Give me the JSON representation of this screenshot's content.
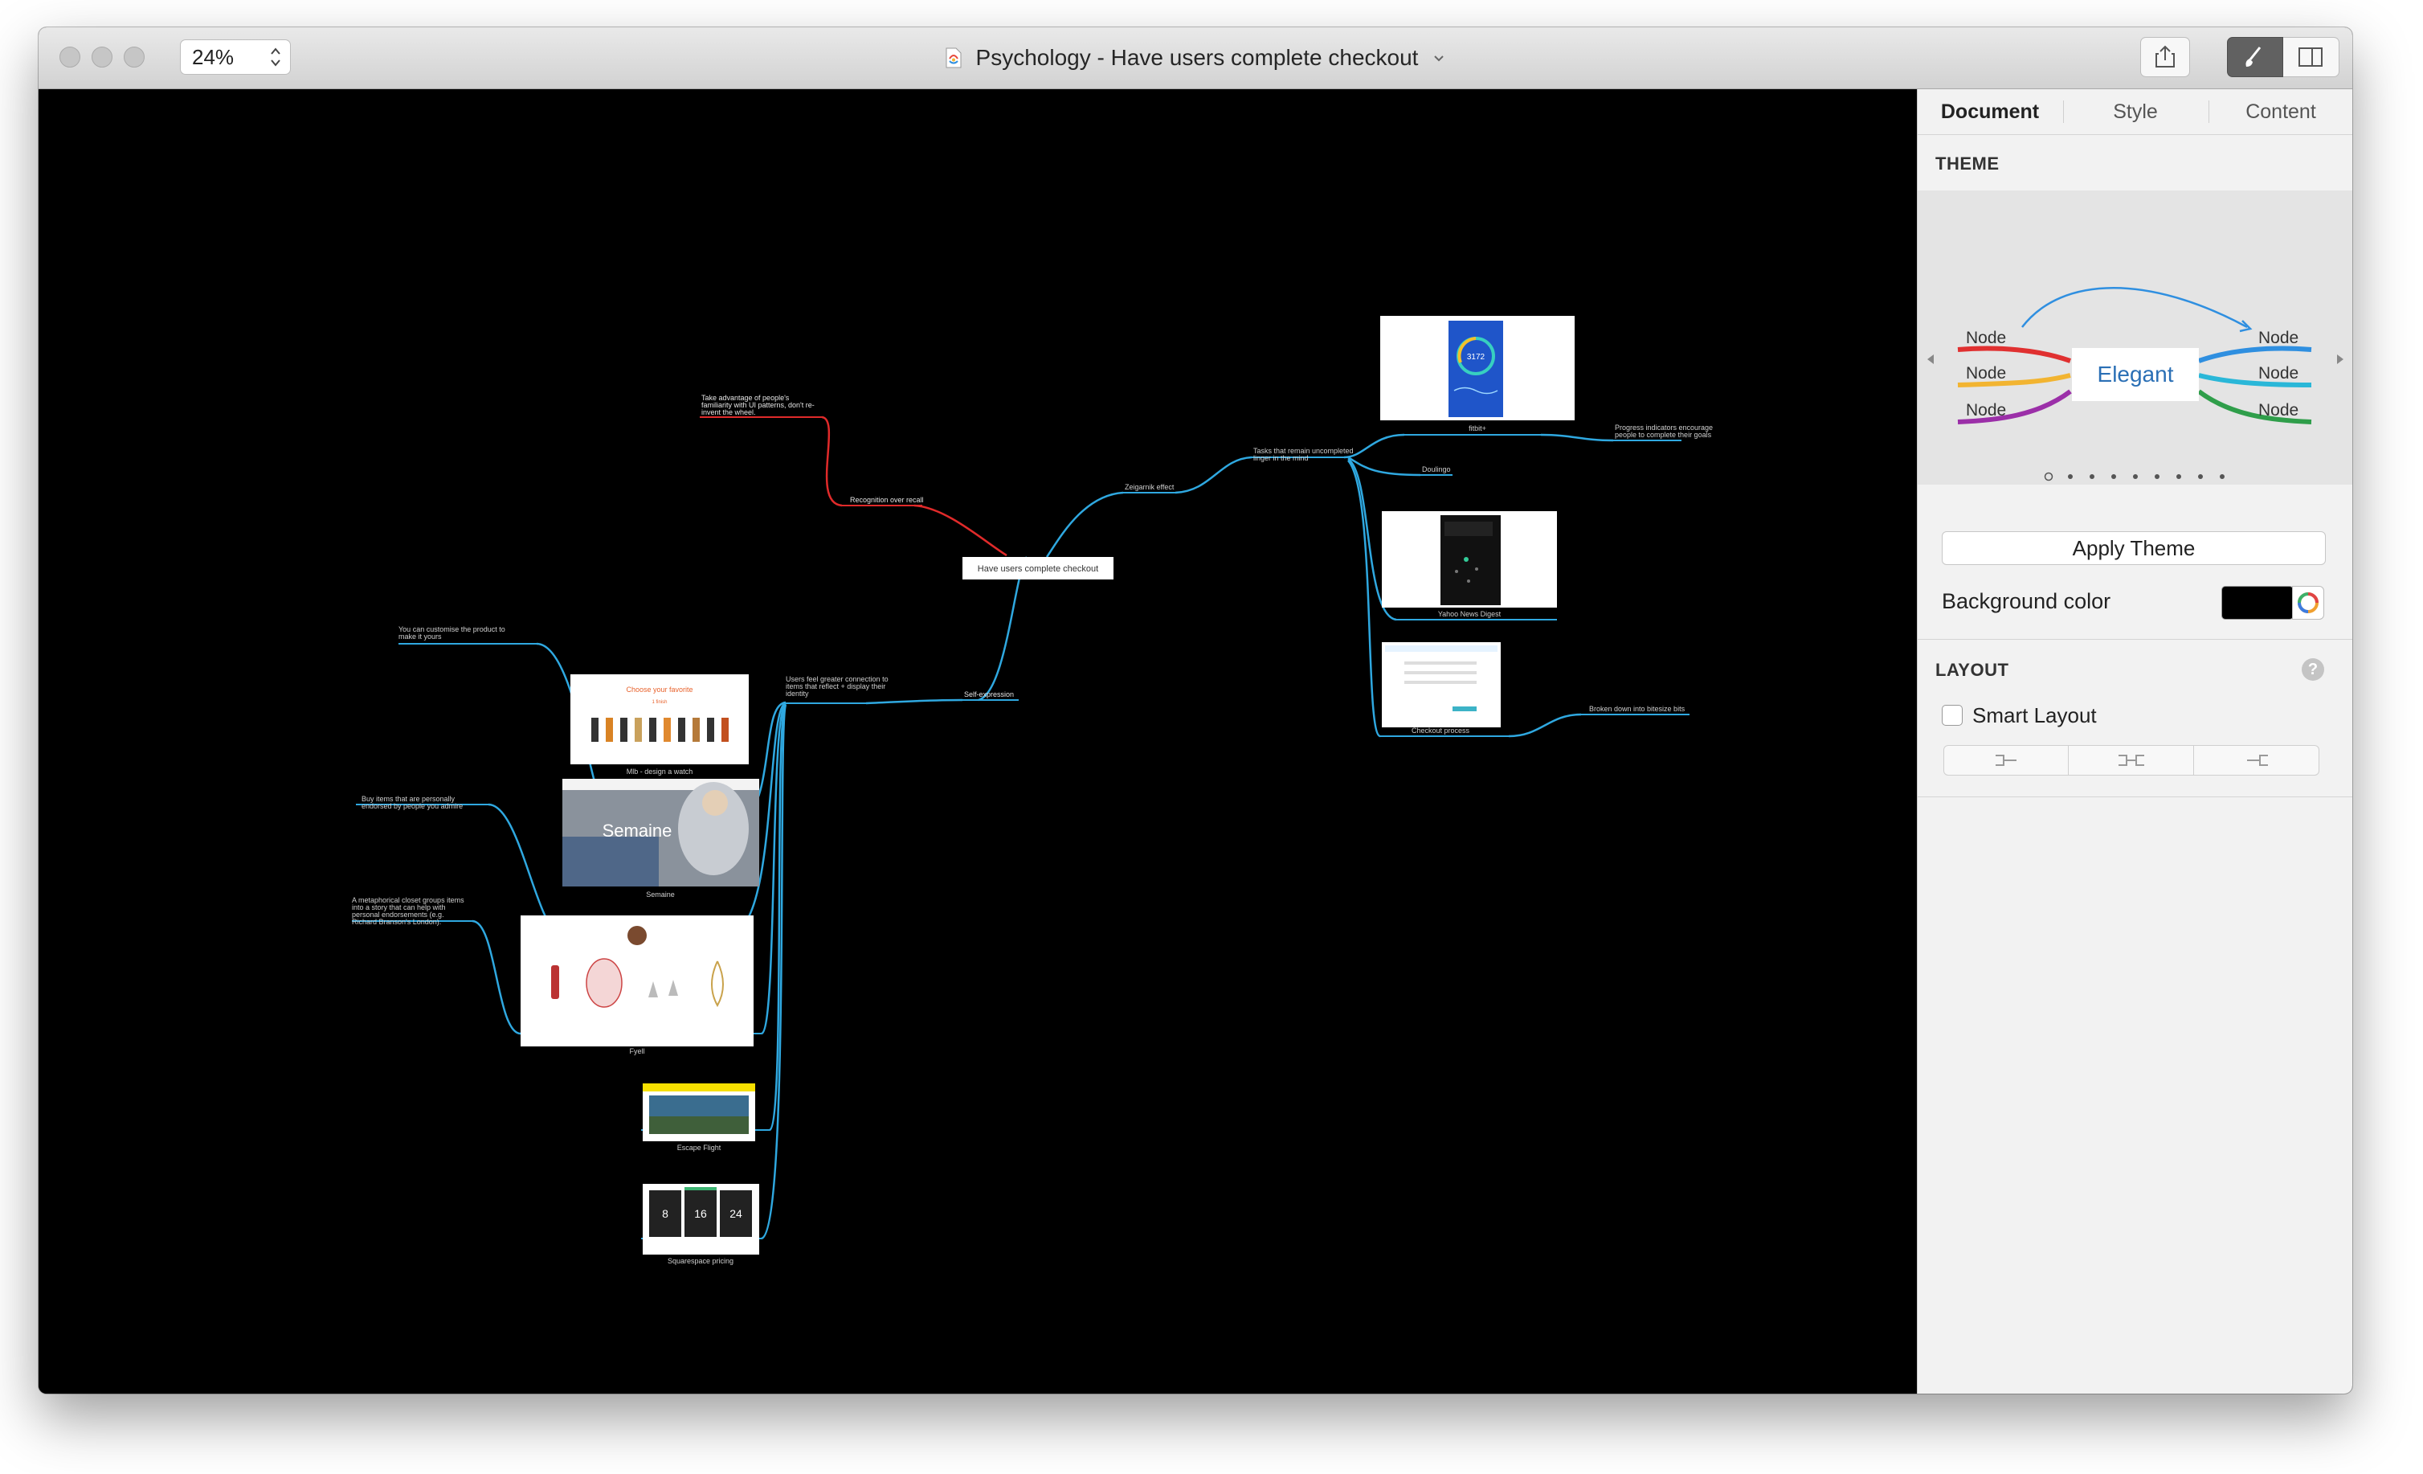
{
  "window": {
    "zoom": "24%",
    "document_title": "Psychology - Have users complete checkout"
  },
  "icons": {
    "share": "share-icon",
    "brush": "brush-icon",
    "sidebar_toggle": "sidebar-toggle-icon",
    "title_chevron": "chevron-down-icon"
  },
  "sidebar": {
    "tabs": [
      "Document",
      "Style",
      "Content"
    ],
    "active_tab": "Document",
    "theme_heading": "THEME",
    "theme_preview": {
      "center": "Elegant",
      "left_nodes": [
        "Node",
        "Node",
        "Node"
      ],
      "right_nodes": [
        "Node",
        "Node",
        "Node"
      ],
      "page_count": 9,
      "active_page": 1
    },
    "apply_theme_label": "Apply Theme",
    "background_color_label": "Background color",
    "background_color": "#000000",
    "layout_heading": "LAYOUT",
    "smart_layout_label": "Smart Layout",
    "smart_layout_checked": false,
    "help_glyph": "?"
  },
  "mindmap": {
    "root": "Have users complete checkout",
    "branches": {
      "recognition": "Recognition over recall",
      "recognition_note": [
        "Take advantage of people's",
        "familiarity with UI patterns, don't re-",
        "invent the wheel."
      ],
      "zeigarnik": "Zeigarnik effect",
      "zeigarnik_note": [
        "Tasks that remain uncompleted",
        "linger in the mind"
      ],
      "fitbit": "fitbit+",
      "fitbit_value": "3172",
      "progress_note": [
        "Progress indicators encourage",
        "people to complete their goals"
      ],
      "duolingo": "Doulingo",
      "yahoo": "Yahoo News Digest",
      "checkout": "Checkout process",
      "checkout_note": "Broken down into bitesize bits",
      "self_expression": "Self-expression",
      "self_expression_note": [
        "Users feel greater connection to",
        "items that reflect + display their",
        "identity"
      ],
      "mlb": "Mlb - design a watch",
      "mlb_note": [
        "You can customise the product  to",
        "make it yours"
      ],
      "mlb_heading": "Choose your favorite",
      "mlb_sub": "1 finish",
      "semaine": "Semaine",
      "semaine_note": [
        "Buy items that are personally",
        "endorsed by people you admire"
      ],
      "fyell": "Fyell",
      "fyell_note": [
        "A metaphorical closet groups items",
        "into a story that can help with",
        "personal endorsements (e.g.",
        "Richard Branson's London)."
      ],
      "escape": "Escape Flight",
      "squarespace": "Squarespace pricing",
      "squarespace_prices": [
        "8",
        "16",
        "24"
      ]
    }
  }
}
